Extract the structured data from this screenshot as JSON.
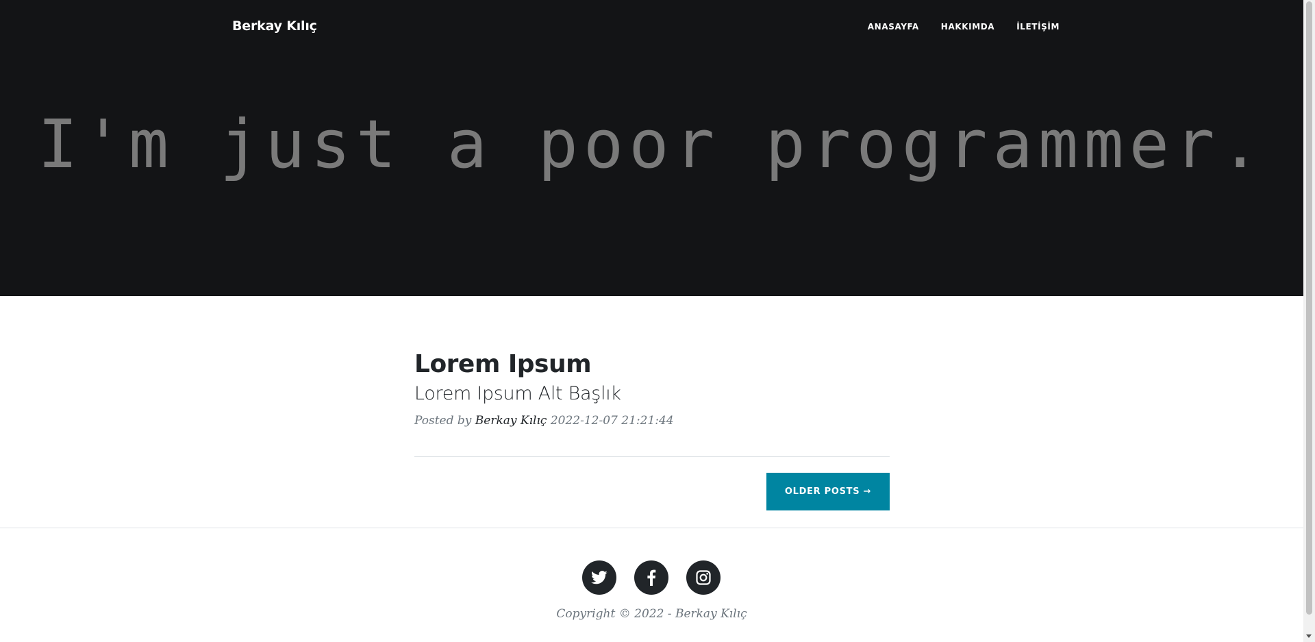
{
  "navbar": {
    "brand": "Berkay Kılıç",
    "links": [
      "ANASAYFA",
      "HAKKIMDA",
      "İLETİŞİM"
    ]
  },
  "hero": {
    "text": "I'm just a poor programmer."
  },
  "post": {
    "title": "Lorem Ipsum",
    "subtitle": "Lorem Ipsum Alt Başlık",
    "posted_by": "Posted by",
    "author": "Berkay Kılıç",
    "date": "2022-12-07 21:21:44"
  },
  "pager": {
    "older_label": "OLDER POSTS →"
  },
  "footer": {
    "socials": [
      "twitter-icon",
      "facebook-icon",
      "instagram-icon"
    ],
    "copyright": "Copyright © 2022 - Berkay Kılıç"
  },
  "colors": {
    "header_bg": "#131416",
    "accent": "#0085a1",
    "text_dark": "#212529",
    "text_muted": "#6c757d"
  }
}
